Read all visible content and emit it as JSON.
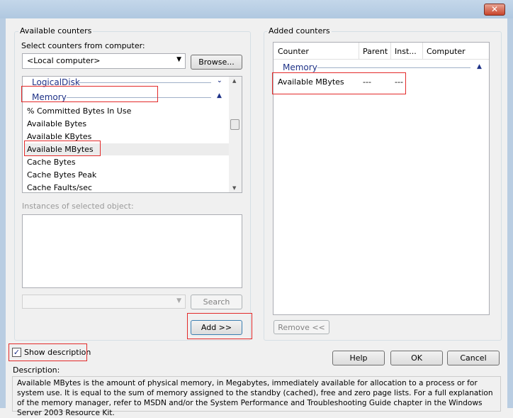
{
  "window": {
    "close_icon": "close-icon"
  },
  "available": {
    "title": "Available counters",
    "computer_label": "Select counters from computer:",
    "computer_value": "<Local computer>",
    "browse": "Browse...",
    "groups": [
      "LogicalDisk",
      "Memory"
    ],
    "counters": [
      "% Committed Bytes In Use",
      "Available Bytes",
      "Available KBytes",
      "Available MBytes",
      "Cache Bytes",
      "Cache Bytes Peak",
      "Cache Faults/sec"
    ],
    "selected_counter": "Available MBytes",
    "instances_label": "Instances of selected object:",
    "search": "Search",
    "add": "Add >>"
  },
  "added": {
    "title": "Added counters",
    "columns": [
      "Counter",
      "Parent",
      "Inst...",
      "Computer"
    ],
    "group": "Memory",
    "rows": [
      {
        "counter": "Available MBytes",
        "parent": "---",
        "instance": "---",
        "computer": ""
      }
    ],
    "remove": "Remove <<"
  },
  "show_description": {
    "label": "Show description",
    "checked": true
  },
  "buttons": {
    "help": "Help",
    "ok": "OK",
    "cancel": "Cancel"
  },
  "description": {
    "label": "Description:",
    "text": "Available MBytes is the amount of physical memory, in Megabytes, immediately available for allocation to a process or for system use. It is equal to the sum of memory assigned to the standby (cached), free and zero page lists. For a full explanation of the memory manager, refer to MSDN and/or the System Performance and Troubleshooting Guide chapter in the Windows Server 2003 Resource Kit."
  }
}
